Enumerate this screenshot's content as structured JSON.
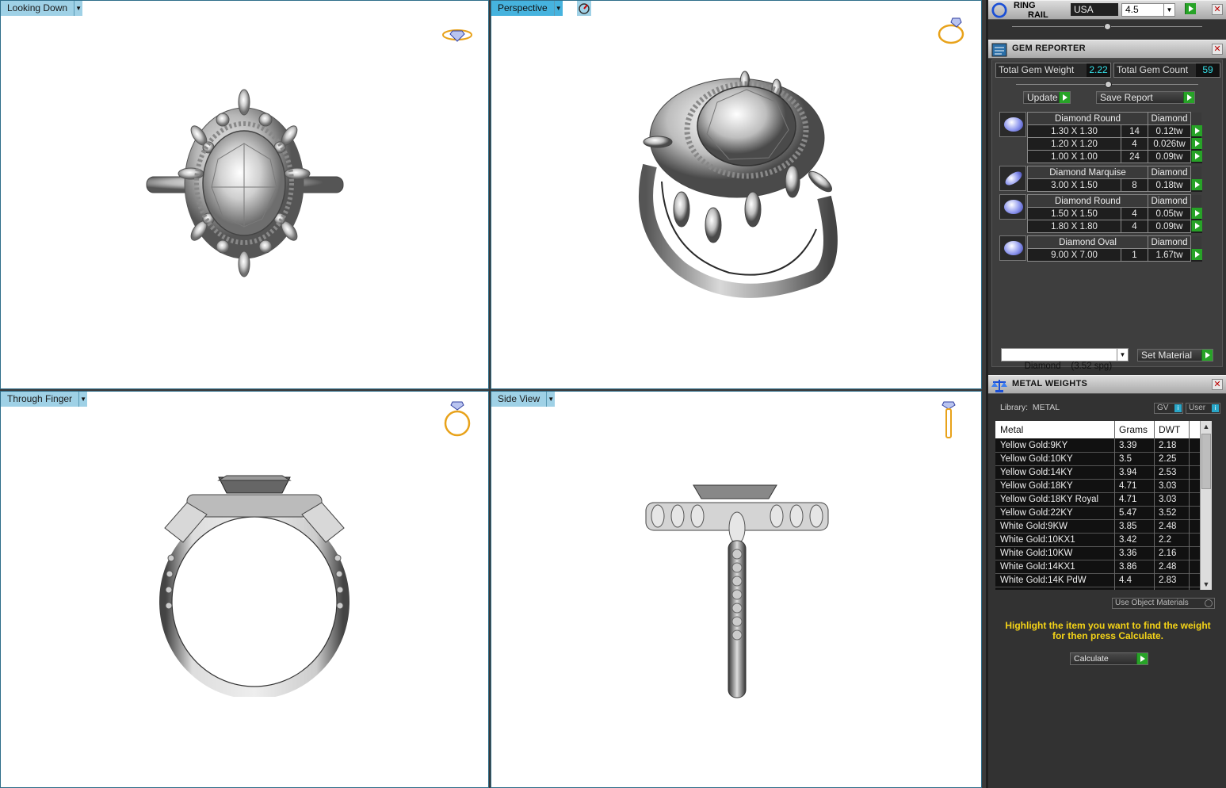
{
  "viewports": {
    "top_left": {
      "label": "Looking Down"
    },
    "top_right": {
      "label": "Perspective"
    },
    "bottom_left": {
      "label": "Through Finger"
    },
    "bottom_right": {
      "label": "Side View"
    }
  },
  "ring_rail": {
    "title_line1": "RING",
    "title_line2": "RAIL",
    "region": "USA",
    "size": "4.5"
  },
  "gem_reporter": {
    "title": "GEM REPORTER",
    "total_weight_label": "Total Gem Weight",
    "total_weight_value": "2.22",
    "total_count_label": "Total Gem Count",
    "total_count_value": "59",
    "update_label": "Update",
    "save_label": "Save Report",
    "groups": [
      {
        "name": "Diamond Round",
        "material": "Diamond",
        "rows": [
          {
            "size": "1.30 X 1.30",
            "count": "14",
            "weight": "0.12tw"
          },
          {
            "size": "1.20 X 1.20",
            "count": "4",
            "weight": "0.026tw"
          },
          {
            "size": "1.00 X 1.00",
            "count": "24",
            "weight": "0.09tw"
          }
        ]
      },
      {
        "name": "Diamond Marquise",
        "material": "Diamond",
        "rows": [
          {
            "size": "3.00 X 1.50",
            "count": "8",
            "weight": "0.18tw"
          }
        ]
      },
      {
        "name": "Diamond Round",
        "material": "Diamond",
        "rows": [
          {
            "size": "1.50 X 1.50",
            "count": "4",
            "weight": "0.05tw"
          },
          {
            "size": "1.80 X 1.80",
            "count": "4",
            "weight": "0.09tw"
          }
        ]
      },
      {
        "name": "Diamond Oval",
        "material": "Diamond",
        "rows": [
          {
            "size": "9.00 X 7.00",
            "count": "1",
            "weight": "1.67tw"
          }
        ]
      }
    ],
    "material_select": "Diamond    (3.52 spg)",
    "set_material_label": "Set Material"
  },
  "metal_weights": {
    "title": "METAL WEIGHTS",
    "library_label": "Library:  METAL",
    "gv_label": "GV",
    "user_label": "User",
    "headers": [
      "Metal",
      "Grams",
      "DWT"
    ],
    "rows": [
      [
        "Yellow Gold:9KY",
        "3.39",
        "2.18"
      ],
      [
        "Yellow Gold:10KY",
        "3.5",
        "2.25"
      ],
      [
        "Yellow Gold:14KY",
        "3.94",
        "2.53"
      ],
      [
        "Yellow Gold:18KY",
        "4.71",
        "3.03"
      ],
      [
        "Yellow Gold:18KY Royal",
        "4.71",
        "3.03"
      ],
      [
        "Yellow Gold:22KY",
        "5.47",
        "3.52"
      ],
      [
        "White Gold:9KW",
        "3.85",
        "2.48"
      ],
      [
        "White Gold:10KX1",
        "3.42",
        "2.2"
      ],
      [
        "White Gold:10KW",
        "3.36",
        "2.16"
      ],
      [
        "White Gold:14KX1",
        "3.86",
        "2.48"
      ],
      [
        "White Gold:14K PdW",
        "4.4",
        "2.83"
      ]
    ],
    "use_object_label": "Use Object Materials",
    "note": "Highlight the item you want to find the weight for then press Calculate.",
    "calculate_label": "Calculate"
  }
}
